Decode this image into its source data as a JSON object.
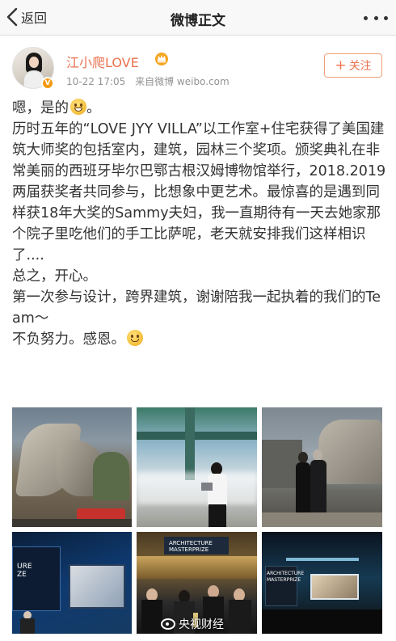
{
  "nav": {
    "back_label": "返回",
    "title": "微博正文"
  },
  "author": {
    "name": "江小爬LOVE",
    "badge_color": "#f39a12",
    "name_color": "#eb7350"
  },
  "meta": {
    "time": "10-22 17:05",
    "source": "来自微博 weibo.com"
  },
  "follow": {
    "plus": "+",
    "label": "关注"
  },
  "post": {
    "line1": "嗯，是的",
    "paragraph1": "历时五年的“LOVE JYY VILLA”以工作室+住宅获得了美国建筑大师奖的包括室内，建筑，园林三个奖项。颁奖典礼在非常美丽的西班牙毕尔巴鄂古根汉姆博物馆举行，2018.2019两届获奖者共同参与，比想象中更艺术。最惊喜的是遇到同样获18年大奖的Sammy夫妇，我一直期待有一天去她家那个院子里吃他们的手工比萨呢，老天就安排我们这样相识了....",
    "line_happy": "总之，开心。",
    "line_team": "第一次参与设计，跨界建筑，谢谢陪我一起执着的我们的Team～",
    "line_end": "不负努力。感恩。"
  },
  "photos": {
    "p4_screen_text": "URE\nZE",
    "p5_screen_text": "ARCHITECTURE\nMASTERPRIZE",
    "p6_screen_text": "ARCHITECTURE\nMASTERPRIZE",
    "watermark": "央视财经"
  },
  "icons": [
    "back-arrow-icon",
    "more-dots-icon",
    "crown-icon",
    "verified-icon",
    "grin-emoji-icon",
    "smile-emoji-icon"
  ]
}
